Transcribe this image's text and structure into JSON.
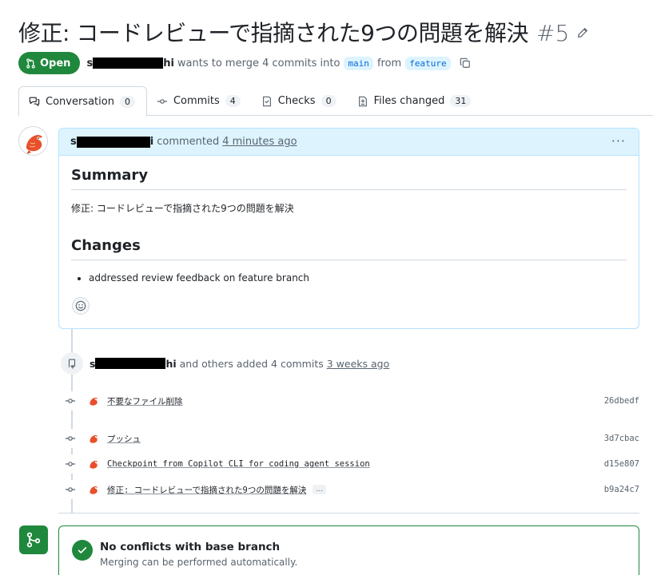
{
  "pr": {
    "title": "修正: コードレビューで指摘された9つの問題を解決",
    "number": "#5",
    "state": "Open",
    "author_prefix": "s",
    "author_suffix": "hi",
    "merge_text": "wants to merge 4 commits into",
    "base_branch": "main",
    "from_text": "from",
    "head_branch": "feature"
  },
  "tabs": [
    {
      "label": "Conversation",
      "count": "0"
    },
    {
      "label": "Commits",
      "count": "4"
    },
    {
      "label": "Checks",
      "count": "0"
    },
    {
      "label": "Files changed",
      "count": "31"
    }
  ],
  "comment": {
    "author_prefix": "s",
    "author_suffix": "i",
    "action": "commented",
    "time": "4 minutes ago",
    "summary_heading": "Summary",
    "summary_text": "修正: コードレビューで指摘された9つの問題を解決",
    "changes_heading": "Changes",
    "changes_items": [
      "addressed review feedback on feature branch"
    ]
  },
  "push_event": {
    "author_prefix": "s",
    "author_suffix": "hi",
    "text": "and others added 4 commits",
    "time": "3 weeks ago"
  },
  "commits": [
    {
      "message": "不要なファイル削除",
      "sha": "26dbedf"
    },
    {
      "message": "プッシュ",
      "sha": "3d7cbac"
    },
    {
      "message": "Checkpoint from Copilot CLI for coding agent session",
      "sha": "d15e807"
    },
    {
      "message": "修正: コードレビューで指摘された9つの問題を解決",
      "sha": "b9a24c7",
      "more": "…"
    }
  ],
  "merge": {
    "title": "No conflicts with base branch",
    "subtitle": "Merging can be performed automatically."
  },
  "colors": {
    "accent_green": "#1f883d",
    "link_blue": "#0969da",
    "comment_header_bg": "#ddf4ff"
  },
  "icons": [
    "edit-pencil-icon",
    "git-pull-request-icon",
    "copy-icon",
    "conversation-icon",
    "commit-icon",
    "checklist-icon",
    "file-diff-icon",
    "kebab-icon",
    "smiley-icon",
    "repo-push-icon",
    "git-merge-icon",
    "check-icon"
  ]
}
